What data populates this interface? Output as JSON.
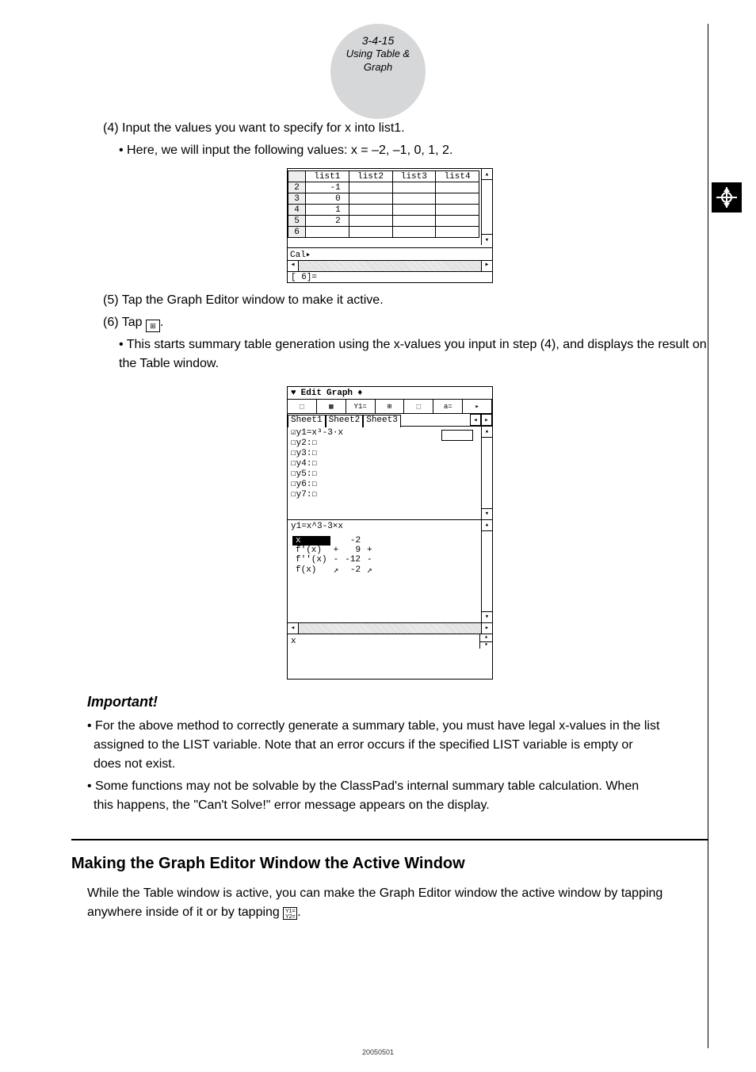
{
  "header": {
    "number": "3-4-15",
    "title": "Using Table & Graph"
  },
  "steps": {
    "s4": "(4) Input the values you want to specify for x into list1.",
    "s4sub": "• Here, we will input the following values: x = –2, –1, 0, 1, 2.",
    "s5": "(5) Tap the Graph Editor window to make it active.",
    "s6": "(6) Tap ",
    "s6sub": "• This starts summary table generation using the x-values you input in step (4), and displays the result on the Table window."
  },
  "screenshot1": {
    "headers": [
      "",
      "list1",
      "list2",
      "list3",
      "list4"
    ],
    "rowlabels": [
      "2",
      "3",
      "4",
      "5",
      "6"
    ],
    "list1values": [
      "-1",
      "0",
      "1",
      "2",
      ""
    ],
    "cal": "Cal▸",
    "input": "[    6]="
  },
  "screenshot2": {
    "menu": [
      "♥",
      "Edit",
      "Graph",
      "♦"
    ],
    "tabs": [
      "Sheet1",
      "Sheet2",
      "Sheet3"
    ],
    "ge_lines": "☑y1=x³-3·x\n☐y2:☐\n☐y3:☐\n☐y4:☐\n☐y5:☐\n☐y6:☐\n☐y7:☐",
    "tbl_header": "y1=x^3-3×x",
    "tbl": {
      "r1": [
        "x",
        "",
        "-2",
        ""
      ],
      "r2": [
        "f'(x)",
        "+",
        "9",
        "+"
      ],
      "r3": [
        "f''(x)",
        "-",
        "-12",
        "-"
      ],
      "r4": [
        "f(x)",
        "↗",
        "-2",
        "↗"
      ]
    },
    "input": "x"
  },
  "important": {
    "heading": "Important!",
    "b1": "• For the above method to correctly generate a summary table, you must have legal x-values in the list assigned to the LIST variable. Note that an error occurs if the specified LIST variable is empty or does not exist.",
    "b2": "• Some functions may not be solvable by the ClassPad's internal summary table calculation. When this happens, the \"Can't Solve!\" error message appears on the display."
  },
  "section": {
    "heading": "Making the Graph Editor Window the Active Window",
    "body_a": "While the Table window is active, you can make the Graph Editor window the active window by tapping anywhere inside of it or by tapping ",
    "body_b": "."
  },
  "footer": "20050501"
}
